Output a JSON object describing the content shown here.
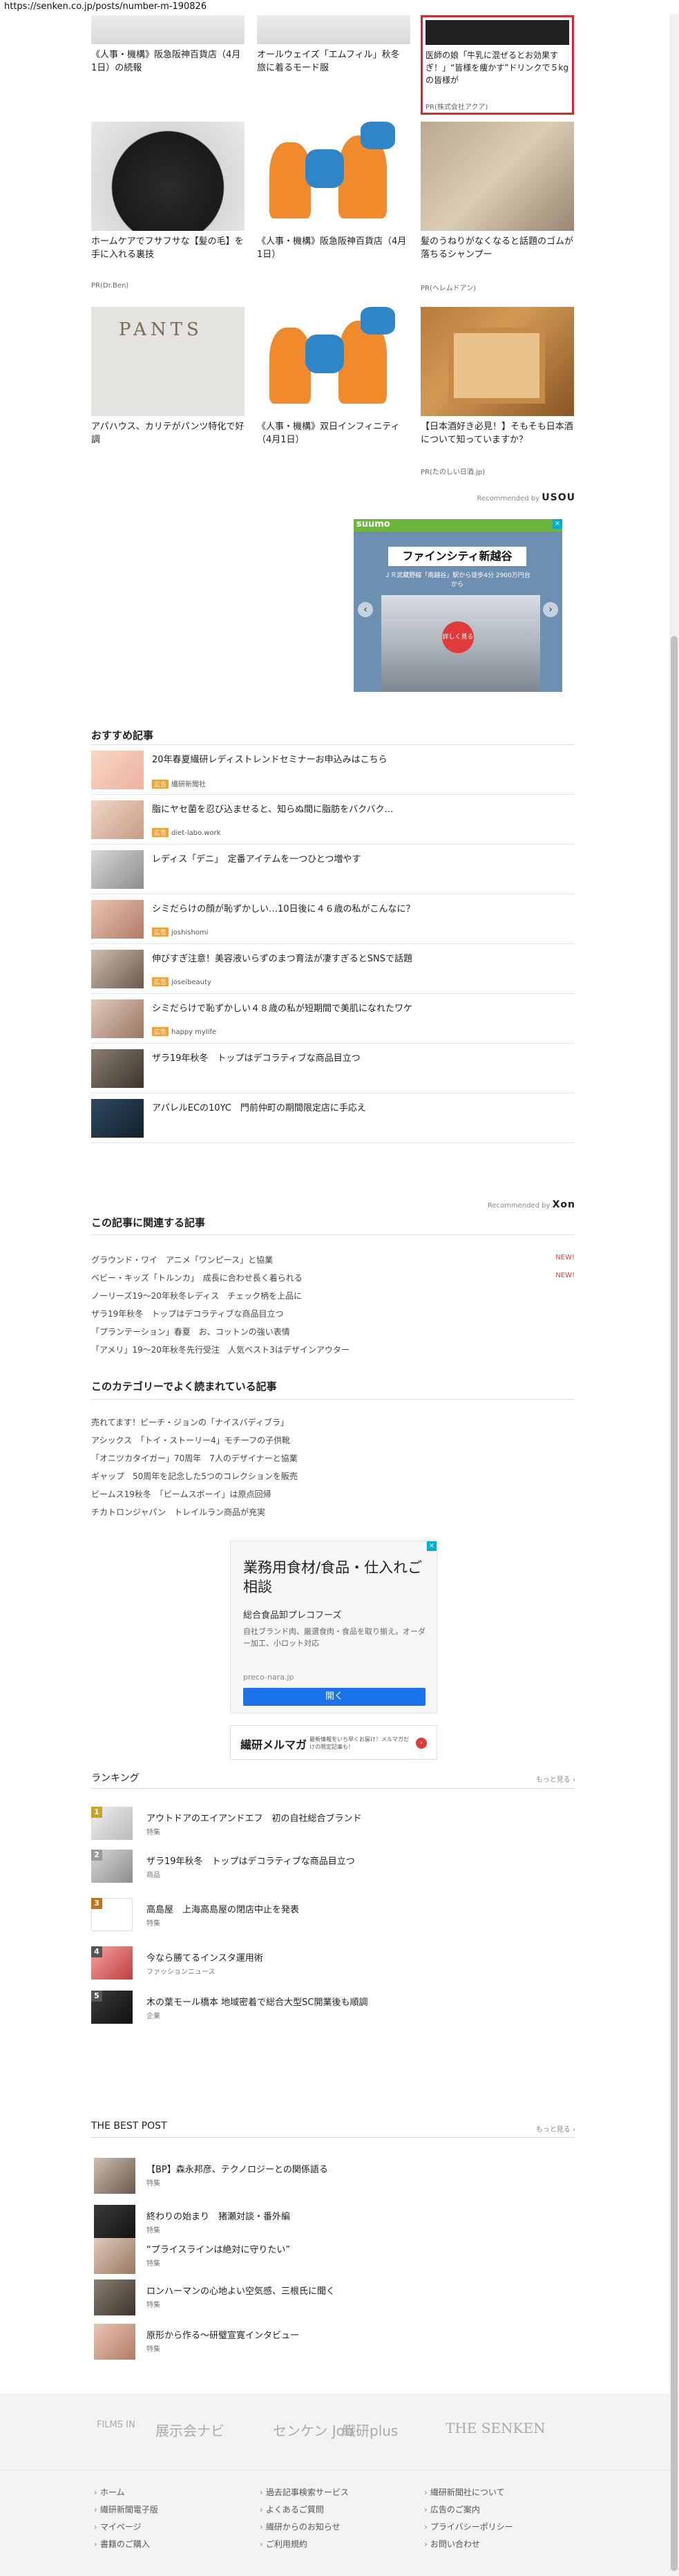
{
  "url": "https://senken.co.jp/posts/number-m-190826",
  "grid": {
    "row1": [
      {
        "title": "《人事・機構》阪急阪神百貨店（4月1日）の続報",
        "pr": ""
      },
      {
        "title": "オールウェイズ「エムフィル」秋冬　旅に着るモード服",
        "pr": ""
      },
      {
        "title": "医師の娘「牛乳に混ぜるとお効果すぎ！」“皆様を痩かす”ドリンクで５kgの皆様が",
        "pr": "PR(株式会社アクア)"
      }
    ],
    "row2": [
      {
        "title": "ホームケアでフサフサな【髪の毛】を手に入れる裏技",
        "pr": "PR(Dr.Ben)"
      },
      {
        "title": "《人事・機構》阪急阪神百貨店（4月1日）",
        "pr": ""
      },
      {
        "title": "髪のうねりがなくなると話題のゴムが落ちるシャンプー",
        "pr": "PR(ヘレムドアン)"
      }
    ],
    "row3": [
      {
        "title": "アパハウス、カリテがパンツ特化で好調",
        "pr": "",
        "thumb_word": "PANTS"
      },
      {
        "title": "《人事・機構》双日インフィニティ（4月1日）",
        "pr": ""
      },
      {
        "title": "【日本酒好き必見！】そもそも日本酒について知っていますか？",
        "pr": "PR(たのしい日酒.jp)"
      }
    ]
  },
  "recommended_by_label": "Recommended by",
  "recommended_by_brand": "USOU",
  "suumo": {
    "brand": "suumo",
    "ad_mark": "×",
    "title": "ファインシティ新越谷",
    "sub": "ＪＲ武蔵野線「南越谷」駅から徒歩4分  2900万円台から",
    "play": "詳しく見る",
    "prev": "‹",
    "next": "›"
  },
  "osusume": {
    "heading": "おすすめ記事",
    "items": [
      {
        "title": "20年春夏繊研レディストレンドセミナーお申込みはこちら",
        "tag": "広告",
        "src": "繊研新聞社"
      },
      {
        "title": "脂にヤセ菌を忍び込ませると、知らぬ間に脂肪をバクバク…",
        "tag": "広告",
        "src": "diet-labo.work"
      },
      {
        "title": "レディス「デニ」　定番アイテムを一つひとつ増やす",
        "tag": "",
        "src": ""
      },
      {
        "title": "シミだらけの顔が恥ずかしい…10日後に４６歳の私がこんなに？",
        "tag": "広告",
        "src": "joshishomi"
      },
      {
        "title": "伸びすぎ注意！美容液いらずのまつ育法が凄すぎるとSNSで話題",
        "tag": "広告",
        "src": "joseibeauty"
      },
      {
        "title": "シミだらけで恥ずかしい４８歳の私が短期間で美肌になれたワケ",
        "tag": "広告",
        "src": "happy mylife"
      },
      {
        "title": "ザラ19年秋冬　トップはデコラティブな商品目立つ",
        "tag": "",
        "src": ""
      },
      {
        "title": "アパレルECの10YC　門前仲町の期間限定店に手応え",
        "tag": "",
        "src": ""
      }
    ],
    "recommended_label": "Recommended by",
    "recommended_brand": "Xon"
  },
  "related": {
    "heading": "この記事に関連する記事",
    "new_label": "NEW!",
    "items": [
      "グラウンド・ワイ　アニメ「ワンピース」と協業",
      "ベビー・キッズ「トルンカ」　成長に合わせ長く着られる",
      "ノーリーズ19～20年秋冬レディス　チェック柄を上品に",
      "ザラ19年秋冬　トップはデコラティブな商品目立つ",
      "「プランテーション」春夏　お、コットンの強い表情",
      "「アメリ」19～20年秋冬先行受注　人気ベスト3はデザインアウター"
    ]
  },
  "category_popular": {
    "heading": "このカテゴリーでよく読まれている記事",
    "items": [
      "売れてます！ビーチ・ジョンの「ナイスバディブラ」",
      "アシックス　「トイ・ストーリー4」モチーフの子供靴",
      "「オニツカタイガー」70周年　7人のデザイナーと協業",
      "ギャップ　50周年を記念した5つのコレクションを販売",
      "ビームス19秋冬　「ビームスボーイ」は原点回帰",
      "チカトロンジャパン　トレイルラン商品が充実"
    ]
  },
  "ad": {
    "ad_mark": "×",
    "headline": "業務用食材/食品・仕入れご相談",
    "advertiser": "総合食品卸プレコフーズ",
    "body": "自社ブランド肉、厳選食肉・食品を取り揃え。オーダー加工、小ロット対応",
    "url": "preco-nara.jp",
    "cta": "開く"
  },
  "mailmag": {
    "title": "繊研メルマガ",
    "desc": "最新情報をいち早くお届け！メルマガだけの限定記事も！",
    "icon": "›"
  },
  "ranking": {
    "heading": "ランキング",
    "more": "もっと見る ›",
    "items": [
      {
        "num": "1",
        "title": "アウトドアのエイアンドエフ　初の自社総合ブランド",
        "meta": "特集"
      },
      {
        "num": "2",
        "title": "ザラ19年秋冬　トップはデコラティブな商品目立つ",
        "meta": "商品"
      },
      {
        "num": "3",
        "title": "高島屋　上海高島屋の閉店中止を発表",
        "meta": "特集"
      },
      {
        "num": "4",
        "title": "今なら勝てるインスタ運用術",
        "meta": "ファッションニュース"
      },
      {
        "num": "5",
        "title": "木の葉モール橋本 地域密着で総合大型SC開業後も順調",
        "meta": "企業"
      }
    ]
  },
  "best_post": {
    "heading": "THE BEST POST",
    "more": "もっと見る ›",
    "items": [
      {
        "title": "【BP】森永邦彦、テクノロジーとの関係語る",
        "meta": "特集"
      },
      {
        "title": "終わりの始まり　猪瀬対談・番外編",
        "meta": "特集"
      },
      {
        "title": "“プライスラインは絶対に守りたい”",
        "meta": "特集"
      },
      {
        "title": "ロンハーマンの心地よい空気感、三根氏に聞く",
        "meta": "特集"
      },
      {
        "title": "原形から作る～研璧宣寛インタビュー",
        "meta": "特集"
      }
    ]
  },
  "footer_logos": [
    "FILMS IN",
    "展示会ナビ",
    "センケン Job",
    "繊研plus",
    "THE SENKEN"
  ],
  "footer_links": {
    "col1": [
      "ホーム",
      "繊研新聞電子版",
      "マイページ",
      "書籍のご購入"
    ],
    "col2": [
      "過去記事検索サービス",
      "よくあるご質問",
      "繊研からのお知らせ",
      "ご利用規約"
    ],
    "col3": [
      "繊研新聞社について",
      "広告のご案内",
      "プライバシーポリシー",
      "お問い合わせ"
    ]
  }
}
